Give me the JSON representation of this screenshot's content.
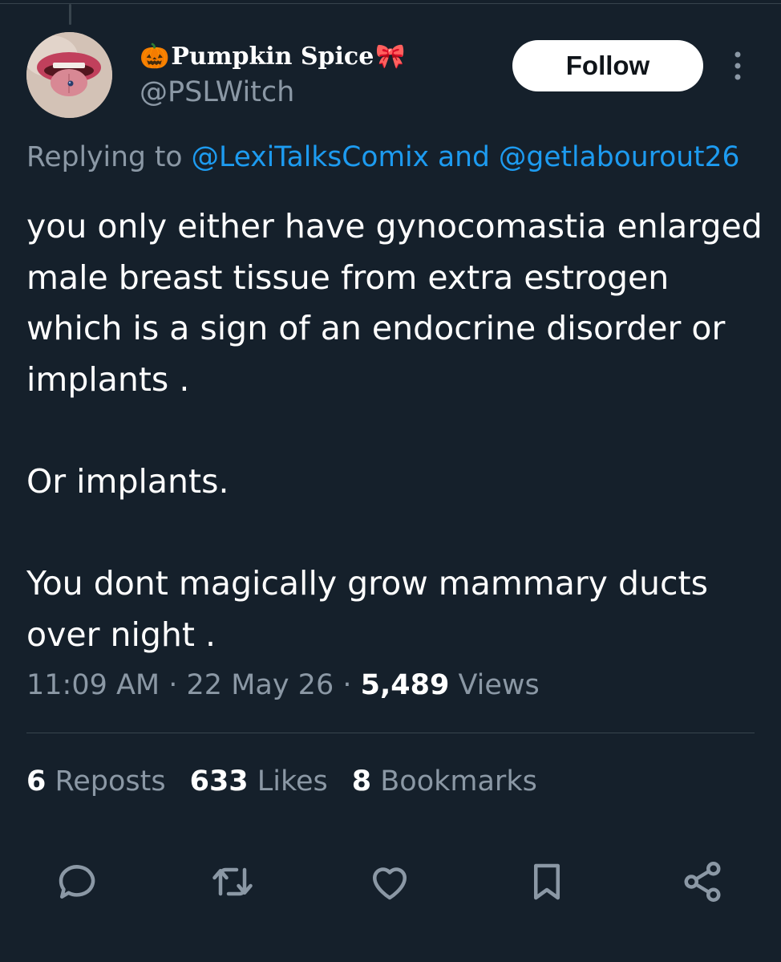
{
  "user": {
    "display_name": "Pumpkin Spice",
    "name_prefix_emoji": "🎃",
    "name_suffix_emoji": "🎀",
    "handle": "@PSLWitch"
  },
  "follow_label": "Follow",
  "reply": {
    "prefix": "Replying to ",
    "mention1": "@LexiTalksComix",
    "conjunction": " and ",
    "mention2": "@getlabourout26"
  },
  "tweet": {
    "p1": "you only either have gynocomastia enlarged male breast tissue from extra estrogen which is a sign of an endocrine disorder or implants .",
    "p2": "Or implants.",
    "p3": "You dont magically grow mammary ducts over night ."
  },
  "meta": {
    "time": "11:09 AM",
    "date": "22 May 26",
    "separator": " · ",
    "views_count": "5,489",
    "views_label": " Views"
  },
  "stats": {
    "reposts_count": "6",
    "reposts_label": " Reposts",
    "likes_count": "633",
    "likes_label": " Likes",
    "bookmarks_count": "8",
    "bookmarks_label": " Bookmarks"
  },
  "icons": {
    "reply": "reply-icon",
    "repost": "repost-icon",
    "like": "heart-icon",
    "bookmark": "bookmark-icon",
    "share": "share-icon",
    "more": "more-icon"
  },
  "colors": {
    "background": "#15202b",
    "secondary_text": "#8b98a5",
    "link": "#1d9bf0",
    "divider": "#38444d"
  }
}
